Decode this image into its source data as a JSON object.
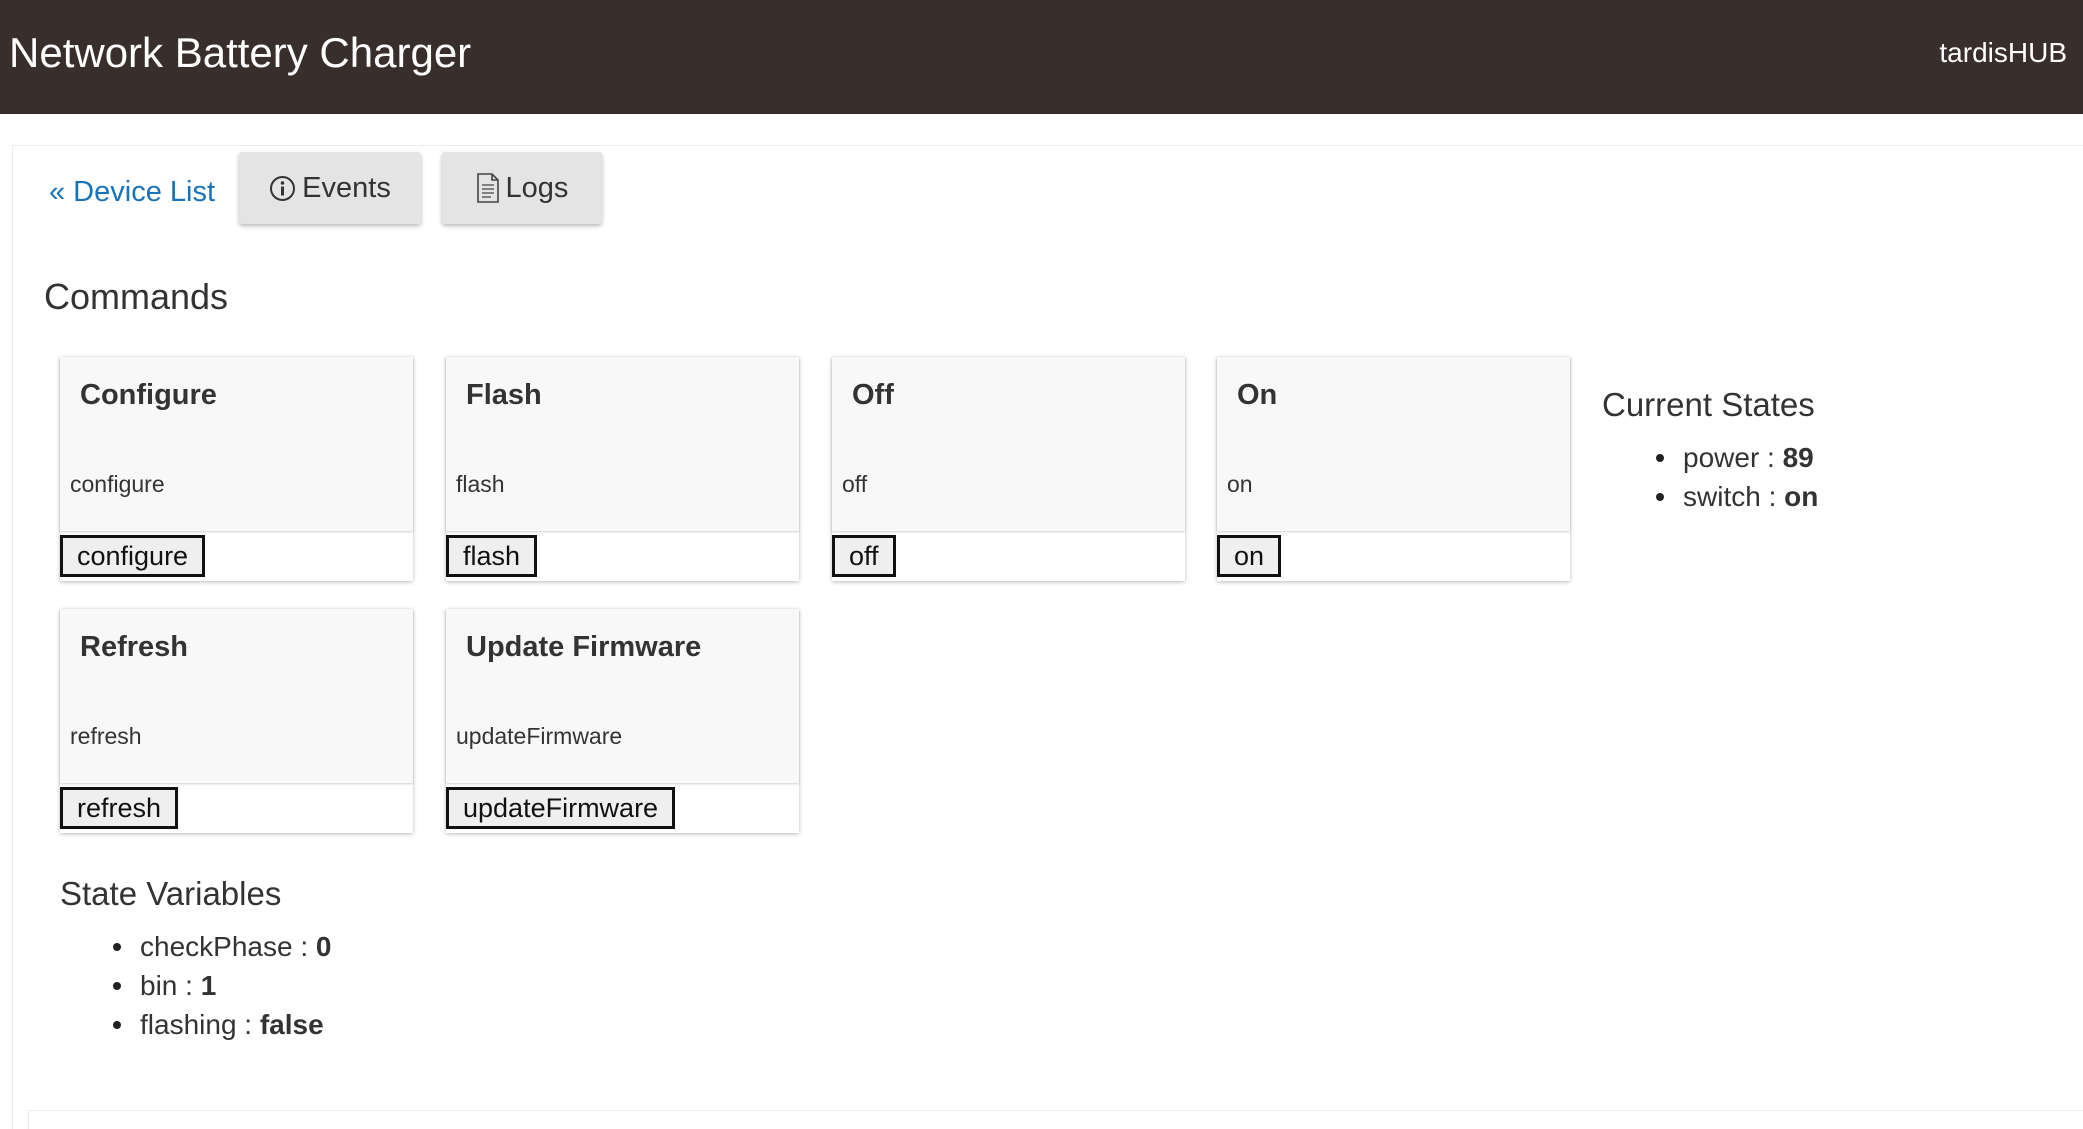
{
  "header": {
    "title": "Network Battery Charger",
    "hub": "tardisHUB"
  },
  "nav": {
    "back_label": "« Device List",
    "events_label": "Events",
    "events_icon": "info-circle-icon",
    "logs_label": "Logs",
    "logs_icon": "document-icon"
  },
  "commands": {
    "title": "Commands",
    "items": [
      {
        "title": "Configure",
        "method": "configure",
        "button": "configure"
      },
      {
        "title": "Flash",
        "method": "flash",
        "button": "flash"
      },
      {
        "title": "Off",
        "method": "off",
        "button": "off"
      },
      {
        "title": "On",
        "method": "on",
        "button": "on"
      },
      {
        "title": "Refresh",
        "method": "refresh",
        "button": "refresh"
      },
      {
        "title": "Update Firmware",
        "method": "updateFirmware",
        "button": "updateFirmware"
      }
    ]
  },
  "current_states": {
    "title": "Current States",
    "items": [
      {
        "key": "power",
        "value": "89"
      },
      {
        "key": "switch",
        "value": "on"
      }
    ]
  },
  "state_variables": {
    "title": "State Variables",
    "items": [
      {
        "key": "checkPhase",
        "value": "0"
      },
      {
        "key": "bin",
        "value": "1"
      },
      {
        "key": "flashing",
        "value": "false"
      }
    ]
  },
  "colors": {
    "header_bg": "#382e2b",
    "link": "#1a73b8",
    "tab_bg": "#e4e4e4"
  }
}
